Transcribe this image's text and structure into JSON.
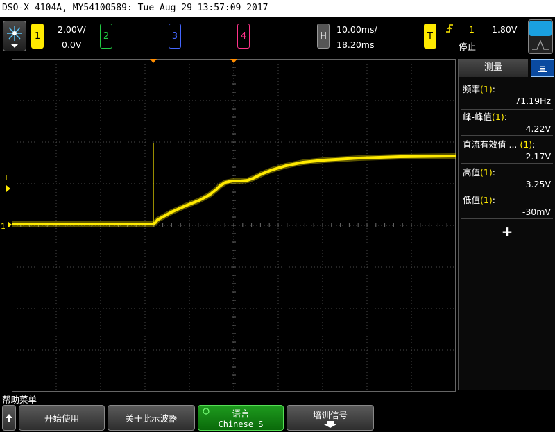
{
  "title_bar": {
    "text": "DSO-X 4104A, MY54100589: Tue Aug 29 13:57:09 2017"
  },
  "channels": [
    {
      "number": "1",
      "scale": "2.00V/",
      "offset": "0.0V",
      "color": "#ffea00"
    },
    {
      "number": "2",
      "color": "#22cc44"
    },
    {
      "number": "3",
      "color": "#4466ff"
    },
    {
      "number": "4",
      "color": "#ff3388"
    }
  ],
  "horizontal": {
    "label": "H",
    "time_per_div": "10.00ms/",
    "delay": "18.20ms"
  },
  "trigger": {
    "label": "T",
    "source": "1",
    "level": "1.80V",
    "status": "停止"
  },
  "waveform_markers": {
    "trigger_level": "T",
    "channel_ground": "1"
  },
  "measurements": {
    "tab_label": "测量",
    "items": [
      {
        "name": "频率",
        "source": "(1)",
        "value": "71.19Hz"
      },
      {
        "name": "峰-峰值",
        "source": "(1)",
        "value": "4.22V"
      },
      {
        "name": "直流有效值 ... ",
        "source": "(1)",
        "value": "2.17V"
      },
      {
        "name": "高值",
        "source": "(1)",
        "value": "3.25V"
      },
      {
        "name": "低值",
        "source": "(1)",
        "value": "-30mV"
      }
    ],
    "add_label": "+"
  },
  "softkeys": {
    "menu_title": "帮助菜单",
    "keys": [
      {
        "label": "开始使用"
      },
      {
        "label": "关于此示波器"
      },
      {
        "label": "语言",
        "sub": "Chinese S"
      },
      {
        "label": "培训信号"
      }
    ]
  },
  "colors": {
    "trace": "#ffea00",
    "grid": "#4a4a4a",
    "accent": "#1e9a1e",
    "panel_blue": "#0a4aa0"
  }
}
